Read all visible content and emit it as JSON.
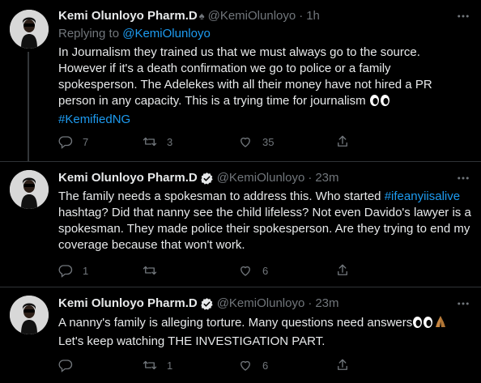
{
  "tweets": [
    {
      "name": "Kemi Olunloyo Pharm.D",
      "name_suffix": "♠",
      "handle": "@KemiOlunloyo",
      "separator": "·",
      "time": "1h",
      "replying_prefix": "Replying to ",
      "replying_to": "@KemiOlunloyo",
      "text": "In Journalism they trained us that we must always go to the source. However if it's a death confirmation we go to police or a family spokesperson. The Adelekes with all their money have not hired a PR person in any capacity. This is a trying time for journalism ",
      "hashtag": "#KemifiedNG",
      "reply_count": "7",
      "retweet_count": "3",
      "like_count": "35"
    },
    {
      "name": "Kemi Olunloyo Pharm.D",
      "name_suffix": "♠",
      "handle": "@KemiOlunloyo",
      "separator": "·",
      "time": "23m",
      "text_before": "The family needs a spokesman to address this. Who started ",
      "hashtag": "#ifeanyiisalive",
      "text_after": " hashtag? Did that nanny see the child lifeless? Not even Davido's lawyer is a spokesman. They made police their spokesperson. Are they trying to end my coverage because that won't work.",
      "reply_count": "1",
      "retweet_count": "",
      "like_count": "6"
    },
    {
      "name": "Kemi Olunloyo Pharm.D",
      "name_suffix": "♠",
      "handle": "@KemiOlunloyo",
      "separator": "·",
      "time": "23m",
      "text_line1": "A nanny's family is alleging torture. Many questions need answers",
      "text_line2": "Let's keep watching THE INVESTIGATION PART.",
      "reply_count": "",
      "retweet_count": "1",
      "like_count": "6"
    }
  ],
  "icons": {
    "more": "more-dots-icon",
    "verified": "verified-badge-icon",
    "reply": "reply-icon",
    "retweet": "retweet-icon",
    "like": "like-icon",
    "share": "share-icon",
    "eyes": "eyes-emoji",
    "pray": "praying-hands-emoji"
  },
  "colors": {
    "background": "#000000",
    "text": "#e7e9ea",
    "muted": "#71767b",
    "link": "#1d9bf0",
    "divider": "#2f3336",
    "thread_line": "#333639"
  }
}
